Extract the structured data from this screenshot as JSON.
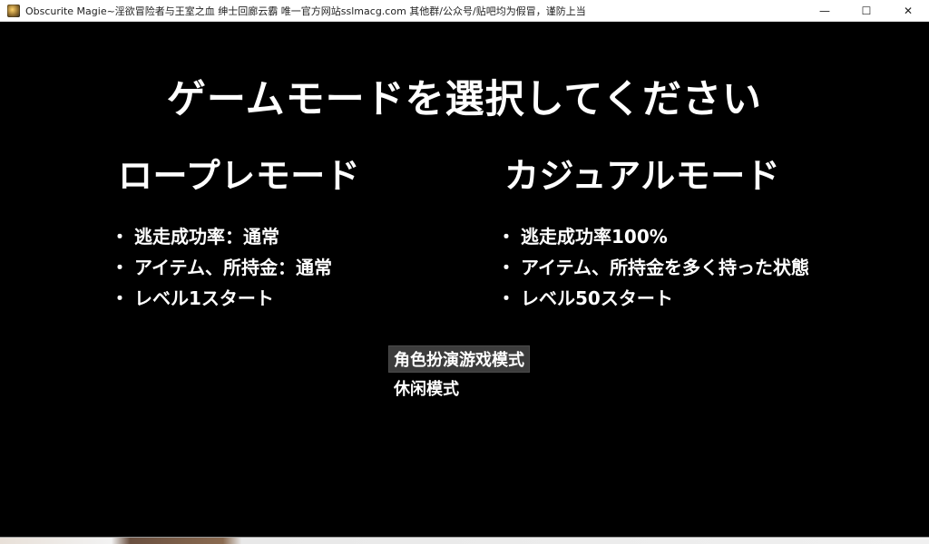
{
  "window": {
    "title": "Obscurite Magie~淫欲冒险者与王室之血 绅士回廊云霸 唯一官方网站sslmacg.com 其他群/公众号/贴吧均为假冒，谨防上当",
    "controls": {
      "minimize": "—",
      "maximize": "☐",
      "close": "✕"
    }
  },
  "screen": {
    "heading": "ゲームモードを選択してください",
    "modes": [
      {
        "title": "ロープレモード",
        "bullets": [
          "逃走成功率：通常",
          "アイテム、所持金：通常",
          "レベル1スタート"
        ]
      },
      {
        "title": "カジュアルモード",
        "bullets": [
          "逃走成功率100%",
          "アイテム、所持金を多く持った状態",
          "レベル50スタート"
        ]
      }
    ],
    "choices": [
      {
        "label": "角色扮演游戏模式",
        "selected": true
      },
      {
        "label": "休闲模式",
        "selected": false
      }
    ]
  },
  "colors": {
    "background": "#000000",
    "text": "#ffffff",
    "selection_bg": "#6e6e6e"
  },
  "icons": {
    "app": "game-app-icon",
    "minimize": "minimize-icon",
    "maximize": "maximize-icon",
    "close": "close-icon"
  }
}
